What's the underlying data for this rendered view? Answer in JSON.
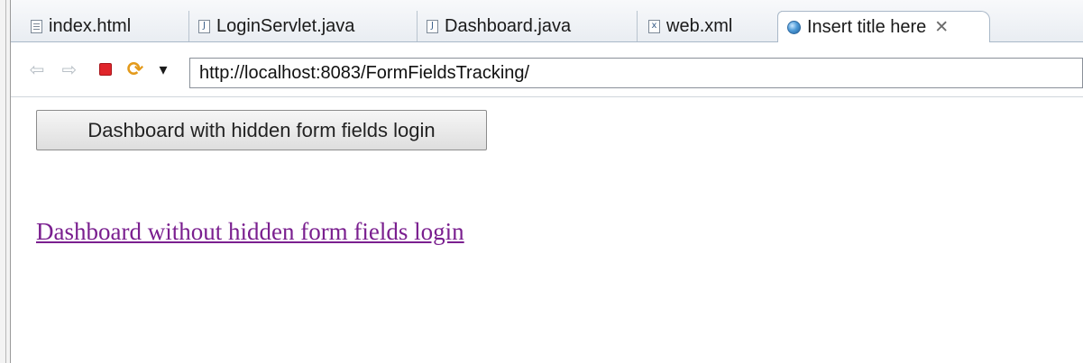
{
  "tabs": [
    {
      "label": "index.html",
      "icon": "html-file-icon"
    },
    {
      "label": "LoginServlet.java",
      "icon": "java-file-icon"
    },
    {
      "label": "Dashboard.java",
      "icon": "java-file-icon"
    },
    {
      "label": "web.xml",
      "icon": "xml-file-icon"
    },
    {
      "label": "Insert title here",
      "icon": "globe-icon",
      "active": true,
      "close": "✕"
    }
  ],
  "navbar": {
    "back_glyph": "⇦",
    "forward_glyph": "⇨",
    "stop_color": "#e0252b",
    "refresh_glyph": "⟳",
    "dropdown_glyph": "▾",
    "url": "http://localhost:8083/FormFieldsTracking/"
  },
  "page": {
    "button_label": "Dashboard with hidden form fields login",
    "link_text": "Dashboard without hidden form fields login",
    "link_color": "#7a1f8f"
  }
}
